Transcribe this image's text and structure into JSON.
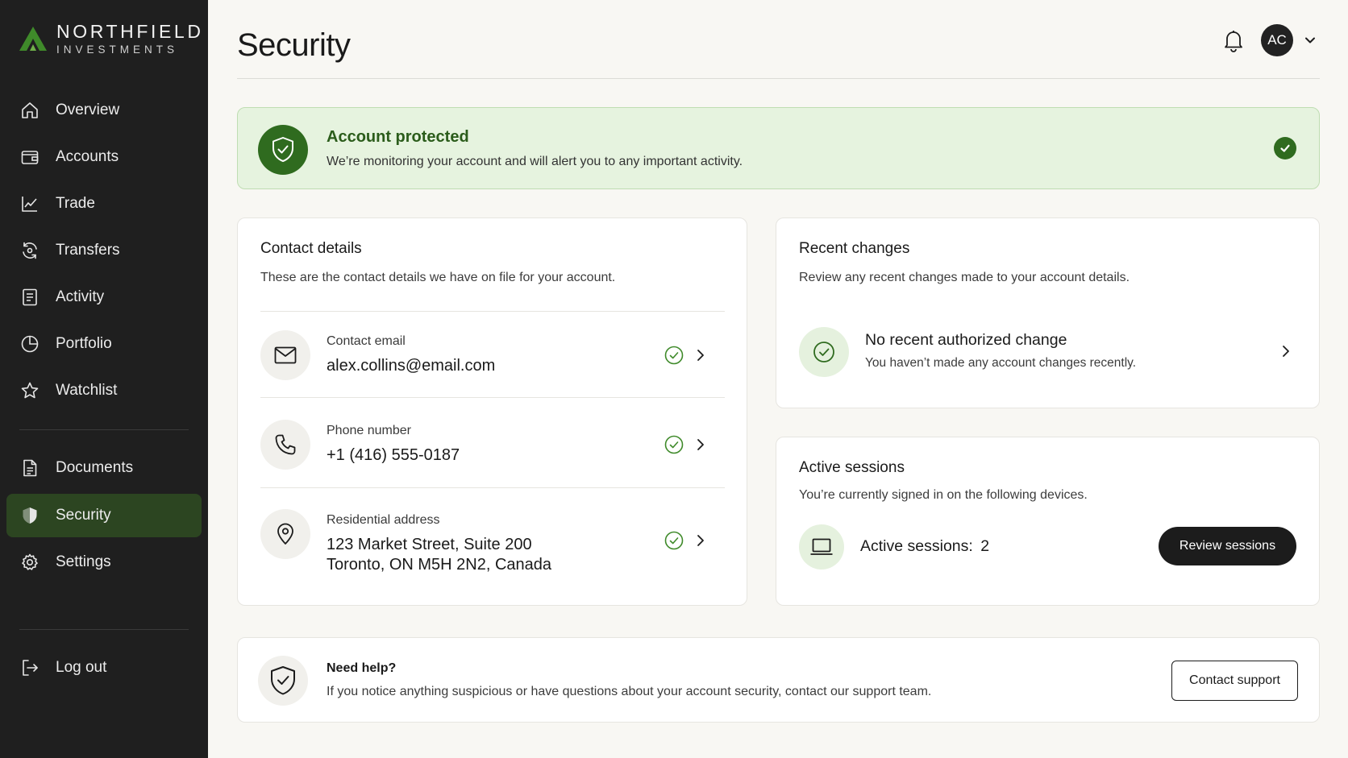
{
  "brand": {
    "name_line1": "NORTHFIELD",
    "name_line2": "INVESTMENTS",
    "color": "#3f8a2a"
  },
  "sidebar": {
    "items": [
      {
        "label": "Overview",
        "icon": "home-icon"
      },
      {
        "label": "Accounts",
        "icon": "wallet-icon"
      },
      {
        "label": "Trade",
        "icon": "chart-line-icon"
      },
      {
        "label": "Transfers",
        "icon": "transfer-icon"
      },
      {
        "label": "Activity",
        "icon": "list-icon"
      },
      {
        "label": "Portfolio",
        "icon": "pie-icon"
      },
      {
        "label": "Watchlist",
        "icon": "star-icon"
      },
      {
        "label": "Documents",
        "icon": "document-icon"
      },
      {
        "label": "Security",
        "icon": "shield-icon",
        "active": true
      },
      {
        "label": "Settings",
        "icon": "gear-icon"
      }
    ],
    "logout_label": "Log out"
  },
  "header": {
    "title": "Security",
    "avatar_initials": "AC"
  },
  "banner": {
    "title": "Account protected",
    "subtitle": "We’re monitoring your account and will alert you to any important activity.",
    "color": "#2f6b1f"
  },
  "contact": {
    "title": "Contact details",
    "subtitle": "These are the contact details we have on file for your account.",
    "items": [
      {
        "label": "Contact email",
        "value": "alex.collins@email.com"
      },
      {
        "label": "Phone number",
        "value": "+1 (416) 555-0187"
      },
      {
        "label": "Residential address",
        "value_line1": "123 Market Street, Suite 200",
        "value_line2": "Toronto, ON M5H 2N2, Canada"
      }
    ]
  },
  "recent": {
    "title": "Recent changes",
    "subtitle": "Review any recent changes made to your account details.",
    "item_title": "No recent authorized change",
    "item_sub": "You haven’t made any account changes recently."
  },
  "sessions": {
    "title": "Active sessions",
    "subtitle": "You’re currently signed in on the following devices.",
    "label": "Active sessions:",
    "count": "2",
    "button": "Review sessions"
  },
  "help": {
    "title": "Need help?",
    "subtitle": "If you notice anything suspicious or have questions about your account security, contact our support team.",
    "button": "Contact support"
  }
}
